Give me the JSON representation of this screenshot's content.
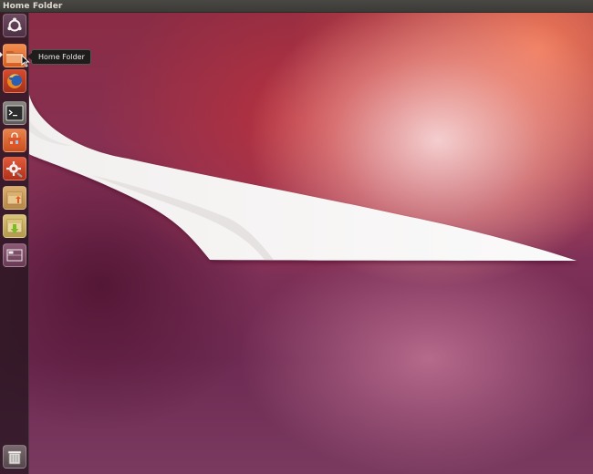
{
  "top_panel": {
    "title": "Home Folder"
  },
  "launcher": {
    "items": [
      {
        "name": "dash-home",
        "icon": "ubuntu-logo-icon"
      },
      {
        "name": "home-folder",
        "icon": "folder-icon",
        "running": true
      },
      {
        "name": "firefox",
        "icon": "firefox-icon"
      },
      {
        "name": "terminal",
        "icon": "terminal-icon"
      },
      {
        "name": "software-center",
        "icon": "shopping-bag-icon"
      },
      {
        "name": "system-settings",
        "icon": "gear-wrench-icon"
      },
      {
        "name": "workspace-archive-up",
        "icon": "archive-upload-icon"
      },
      {
        "name": "workspace-archive-down",
        "icon": "archive-download-icon"
      },
      {
        "name": "workspace-switcher",
        "icon": "workspace-switcher-icon"
      },
      {
        "name": "trash",
        "icon": "trash-icon"
      }
    ]
  },
  "tooltip": {
    "label": "Home Folder"
  },
  "colors": {
    "panel": "#3c3b37",
    "ubuntu_orange": "#dd4814",
    "wallpaper_primary": "#8a2c45"
  }
}
